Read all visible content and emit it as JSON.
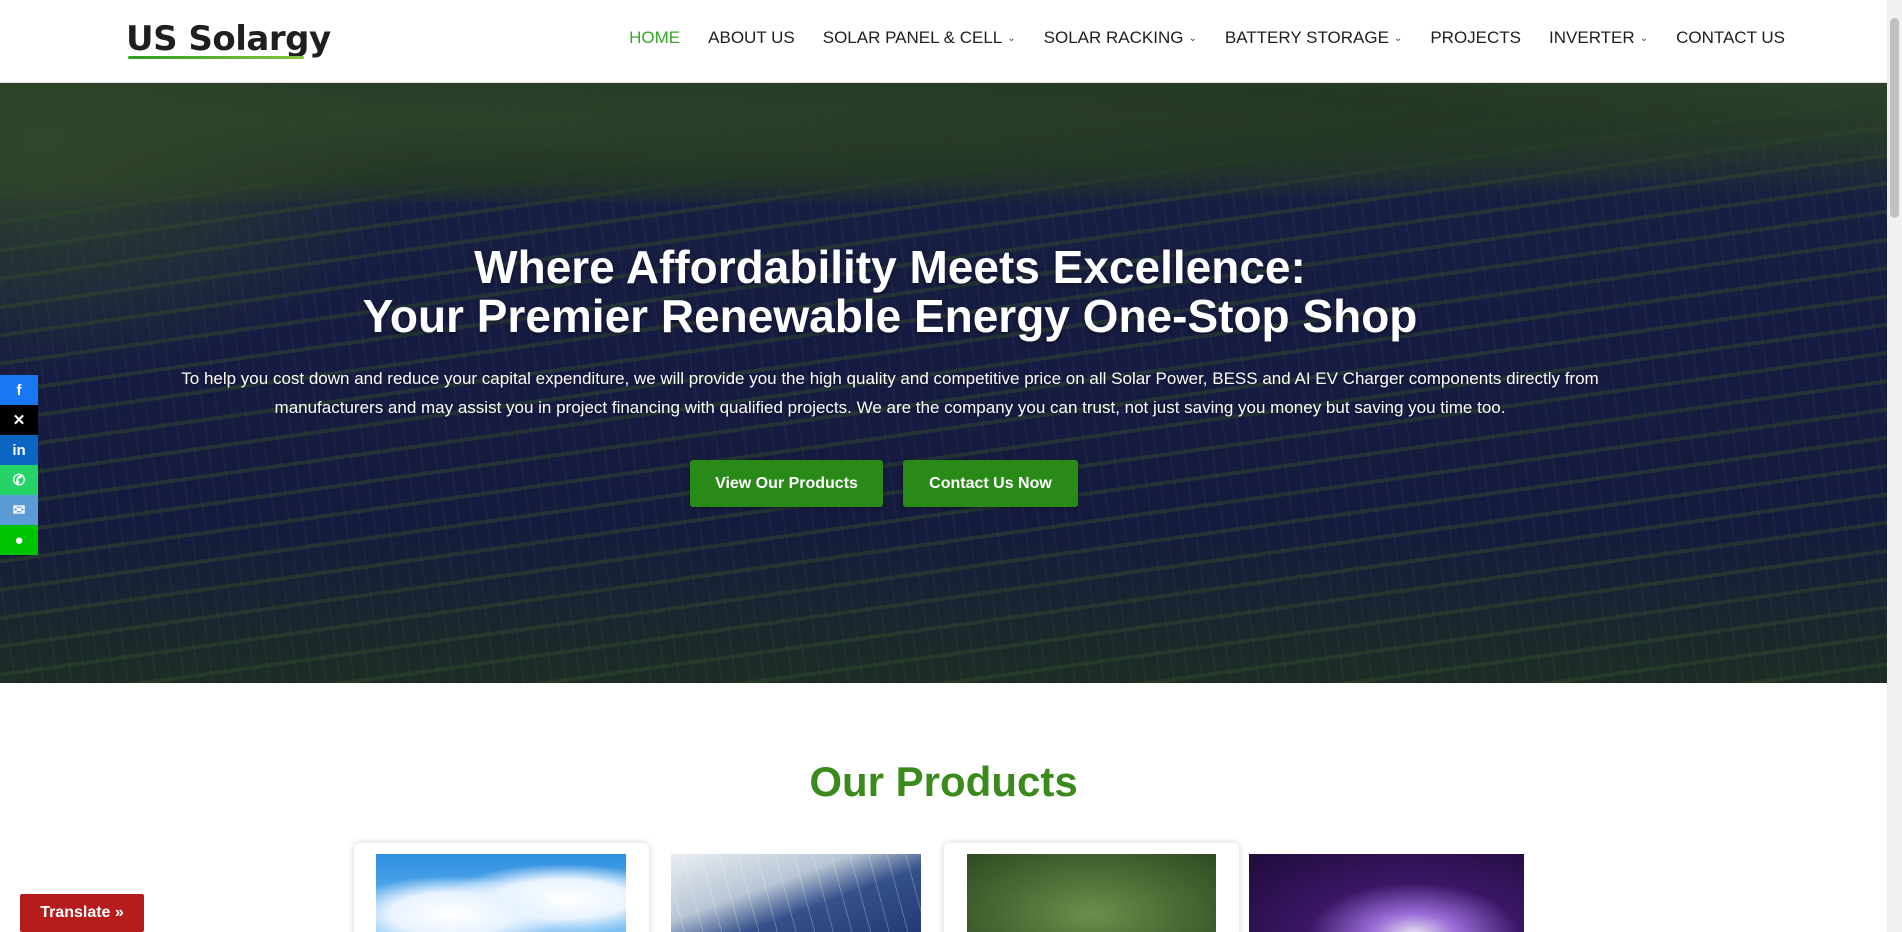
{
  "header": {
    "logo_text": "US Solargy",
    "nav": [
      {
        "label": "HOME",
        "has_dropdown": false,
        "active": true
      },
      {
        "label": "ABOUT US",
        "has_dropdown": false
      },
      {
        "label": "SOLAR PANEL & CELL",
        "has_dropdown": true
      },
      {
        "label": "SOLAR RACKING",
        "has_dropdown": true
      },
      {
        "label": "BATTERY STORAGE",
        "has_dropdown": true
      },
      {
        "label": "PROJECTS",
        "has_dropdown": false
      },
      {
        "label": "INVERTER",
        "has_dropdown": true
      },
      {
        "label": "CONTACT US",
        "has_dropdown": false
      }
    ]
  },
  "hero": {
    "title_line1": "Where Affordability Meets Excellence:",
    "title_line2": "Your Premier Renewable Energy One-Stop Shop",
    "description": "To help you cost down and reduce your capital expenditure, we will provide you the high quality and competitive price on all Solar Power, BESS and AI EV Charger components directly from manufacturers and may assist you in project financing with qualified projects. We are the company you can trust, not just saving you money but saving you time too.",
    "btn_products": "View Our Products",
    "btn_contact": "Contact Us Now"
  },
  "social": [
    {
      "name": "facebook-icon",
      "glyph": "f",
      "color": "#1877f2"
    },
    {
      "name": "x-icon",
      "glyph": "✕",
      "color": "#000000"
    },
    {
      "name": "linkedin-icon",
      "glyph": "in",
      "color": "#0a66c2"
    },
    {
      "name": "whatsapp-icon",
      "glyph": "✆",
      "color": "#25d366"
    },
    {
      "name": "email-icon",
      "glyph": "✉",
      "color": "#5b9bd5"
    },
    {
      "name": "chat-icon",
      "glyph": "●",
      "color": "#00c300"
    }
  ],
  "products": {
    "title": "Our Products"
  },
  "translate": {
    "label": "Translate »"
  },
  "colors": {
    "accent_green": "#3aa52b",
    "button_green": "#2a8a17",
    "products_title": "#3b8a1c",
    "translate_red": "#b71c1c"
  }
}
